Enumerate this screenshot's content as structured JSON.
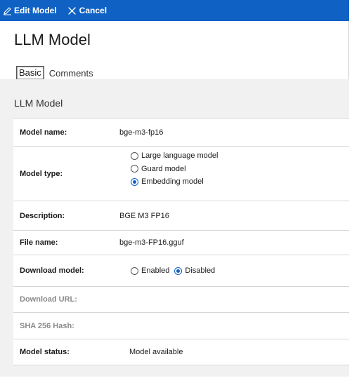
{
  "toolbar": {
    "edit_label": "Edit Model",
    "cancel_label": "Cancel",
    "background": "#0f62c4"
  },
  "page": {
    "title": "LLM Model"
  },
  "tabs": [
    {
      "label": "Basic",
      "selected": true
    },
    {
      "label": "Comments",
      "selected": false
    }
  ],
  "panel": {
    "title": "LLM Model"
  },
  "form": {
    "model_name": {
      "label": "Model name:",
      "value": "bge-m3-fp16"
    },
    "model_type": {
      "label": "Model type:",
      "options": [
        {
          "label": "Large language model",
          "selected": false
        },
        {
          "label": "Guard model",
          "selected": false
        },
        {
          "label": "Embedding model",
          "selected": true
        }
      ]
    },
    "description": {
      "label": "Description:",
      "value": "BGE M3 FP16"
    },
    "file_name": {
      "label": "File name:",
      "value": "bge-m3-FP16.gguf"
    },
    "download_model": {
      "label": "Download model:",
      "options": [
        {
          "label": "Enabled",
          "selected": false
        },
        {
          "label": "Disabled",
          "selected": true
        }
      ]
    },
    "download_url": {
      "label": "Download URL:",
      "value": ""
    },
    "sha_hash": {
      "label": "SHA 256 Hash:",
      "value": ""
    },
    "model_status": {
      "label": "Model status:",
      "value": "Model available"
    }
  },
  "icons": {
    "edit": "pencil-icon",
    "cancel": "close-icon"
  }
}
